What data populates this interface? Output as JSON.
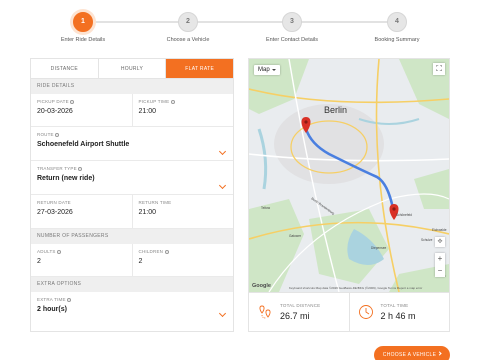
{
  "steps": [
    {
      "number": "1",
      "label": "Enter Ride Details"
    },
    {
      "number": "2",
      "label": "Choose a Vehicle"
    },
    {
      "number": "3",
      "label": "Enter Contact Details"
    },
    {
      "number": "4",
      "label": "Booking Summary"
    }
  ],
  "tabs": [
    "DISTANCE",
    "HOURLY",
    "FLAT RATE"
  ],
  "ride_details": {
    "section": "RIDE DETAILS",
    "pickup_date_label": "PICKUP DATE",
    "pickup_date": "20-03-2026",
    "pickup_time_label": "PICKUP TIME",
    "pickup_time": "21:00",
    "route_label": "ROUTE",
    "route": "Schoenefeld Airport Shuttle",
    "transfer_type_label": "TRANSFER TYPE",
    "transfer_type": "Return (new ride)",
    "return_date_label": "RETURN DATE",
    "return_date": "27-03-2026",
    "return_time_label": "RETURN TIME",
    "return_time": "21:00"
  },
  "passengers": {
    "section": "NUMBER OF PASSENGERS",
    "adults_label": "ADULTS",
    "adults": "2",
    "children_label": "CHILDREN",
    "children": "2"
  },
  "extra": {
    "section": "EXTRA OPTIONS",
    "extra_time_label": "EXTRA TIME",
    "extra_time": "2 hour(s)"
  },
  "map": {
    "type_label": "Map",
    "city_label": "Berlin",
    "labels": [
      "Schönefeld",
      "Zossen",
      "Eichwalde",
      "Teltow",
      "Gatower",
      "Schulze",
      "Berlin Brandenburg",
      "Diepensee"
    ],
    "google": "Google",
    "attribution": "Keyboard shortcuts   Map data ©2026 GeoBasis-DE/BKG (©2009), Google   Terms   Report a map error"
  },
  "stats": {
    "distance_label": "TOTAL DISTANCE",
    "distance": "26.7 mi",
    "time_label": "TOTAL TIME",
    "time": "2 h 46 m"
  },
  "button": "CHOOSE A VEHICLE",
  "colors": {
    "accent": "#f37021",
    "route": "#4a7fe0",
    "pin": "#d93025"
  }
}
